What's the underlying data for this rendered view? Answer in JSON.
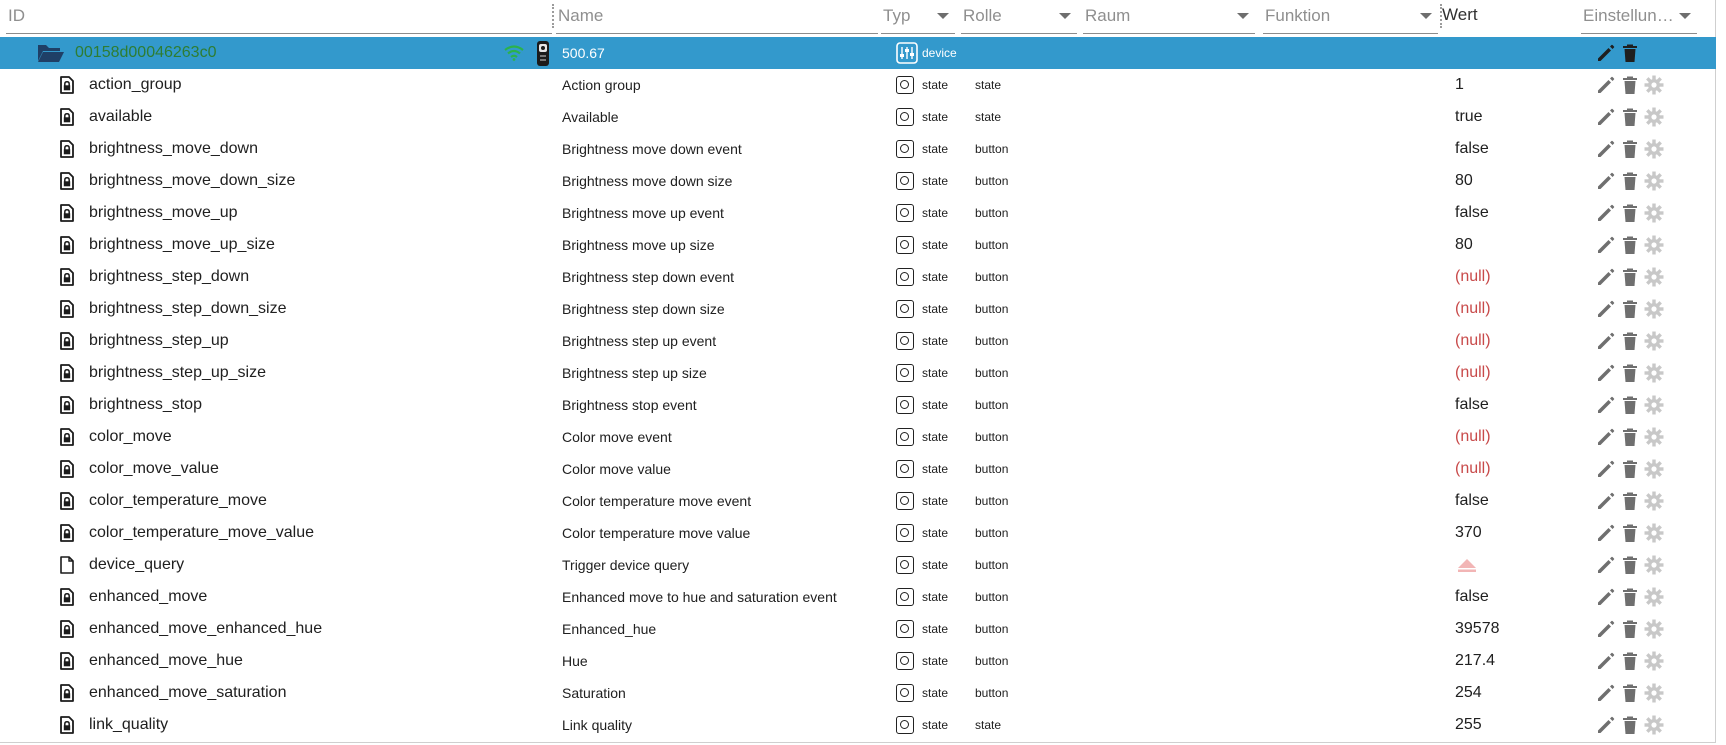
{
  "header": {
    "id_placeholder": "ID",
    "name_placeholder": "Name",
    "typ_placeholder": "Typ",
    "rolle_placeholder": "Rolle",
    "raum_placeholder": "Raum",
    "funktion_placeholder": "Funktion",
    "wert_label": "Wert",
    "einstellungen_placeholder": "Einstellun…"
  },
  "device": {
    "id": "00158d00046263c0",
    "name": "500.67",
    "type": "device"
  },
  "rows": [
    {
      "id": "action_group",
      "name": "Action group",
      "type": "state",
      "role": "state",
      "value": "1",
      "locked": true
    },
    {
      "id": "available",
      "name": "Available",
      "type": "state",
      "role": "state",
      "value": "true",
      "locked": true
    },
    {
      "id": "brightness_move_down",
      "name": "Brightness move down event",
      "type": "state",
      "role": "button",
      "value": "false",
      "locked": true
    },
    {
      "id": "brightness_move_down_size",
      "name": "Brightness move down size",
      "type": "state",
      "role": "button",
      "value": "80",
      "locked": true
    },
    {
      "id": "brightness_move_up",
      "name": "Brightness move up event",
      "type": "state",
      "role": "button",
      "value": "false",
      "locked": true
    },
    {
      "id": "brightness_move_up_size",
      "name": "Brightness move up size",
      "type": "state",
      "role": "button",
      "value": "80",
      "locked": true
    },
    {
      "id": "brightness_step_down",
      "name": "Brightness step down event",
      "type": "state",
      "role": "button",
      "value": "(null)",
      "locked": true
    },
    {
      "id": "brightness_step_down_size",
      "name": "Brightness step down size",
      "type": "state",
      "role": "button",
      "value": "(null)",
      "locked": true
    },
    {
      "id": "brightness_step_up",
      "name": "Brightness step up event",
      "type": "state",
      "role": "button",
      "value": "(null)",
      "locked": true
    },
    {
      "id": "brightness_step_up_size",
      "name": "Brightness step up size",
      "type": "state",
      "role": "button",
      "value": "(null)",
      "locked": true
    },
    {
      "id": "brightness_stop",
      "name": "Brightness stop event",
      "type": "state",
      "role": "button",
      "value": "false",
      "locked": true
    },
    {
      "id": "color_move",
      "name": "Color move event",
      "type": "state",
      "role": "button",
      "value": "(null)",
      "locked": true
    },
    {
      "id": "color_move_value",
      "name": "Color move value",
      "type": "state",
      "role": "button",
      "value": "(null)",
      "locked": true
    },
    {
      "id": "color_temperature_move",
      "name": "Color temperature move event",
      "type": "state",
      "role": "button",
      "value": "false",
      "locked": true
    },
    {
      "id": "color_temperature_move_value",
      "name": "Color temperature move value",
      "type": "state",
      "role": "button",
      "value": "370",
      "locked": true
    },
    {
      "id": "device_query",
      "name": "Trigger device query",
      "type": "state",
      "role": "button",
      "value": "",
      "locked": false
    },
    {
      "id": "enhanced_move",
      "name": "Enhanced move to hue and saturation event",
      "type": "state",
      "role": "button",
      "value": "false",
      "locked": true
    },
    {
      "id": "enhanced_move_enhanced_hue",
      "name": "Enhanced_hue",
      "type": "state",
      "role": "button",
      "value": "39578",
      "locked": true
    },
    {
      "id": "enhanced_move_hue",
      "name": "Hue",
      "type": "state",
      "role": "button",
      "value": "217.4",
      "locked": true
    },
    {
      "id": "enhanced_move_saturation",
      "name": "Saturation",
      "type": "state",
      "role": "button",
      "value": "254",
      "locked": true
    },
    {
      "id": "link_quality",
      "name": "Link quality",
      "type": "state",
      "role": "state",
      "value": "255",
      "locked": true
    }
  ],
  "colors": {
    "selected_row": "#3399cc",
    "device_id": "#2e7d32",
    "null_value": "#c84a4a",
    "icon_gray": "#6f6f6f",
    "gear_gray": "#c8c8c8",
    "wifi_green": "#2bb24c",
    "trigger_pink": "#f2b5b5"
  },
  "icons": {
    "folder": "folder-open-icon",
    "file_locked": "file-lock-icon",
    "file": "file-icon",
    "wifi": "wifi-icon",
    "battery": "remote-battery-icon",
    "device_type": "device-icon",
    "state_type": "state-icon",
    "edit": "edit-icon",
    "delete": "delete-icon",
    "settings": "gear-icon",
    "trigger": "trigger-button-icon"
  }
}
